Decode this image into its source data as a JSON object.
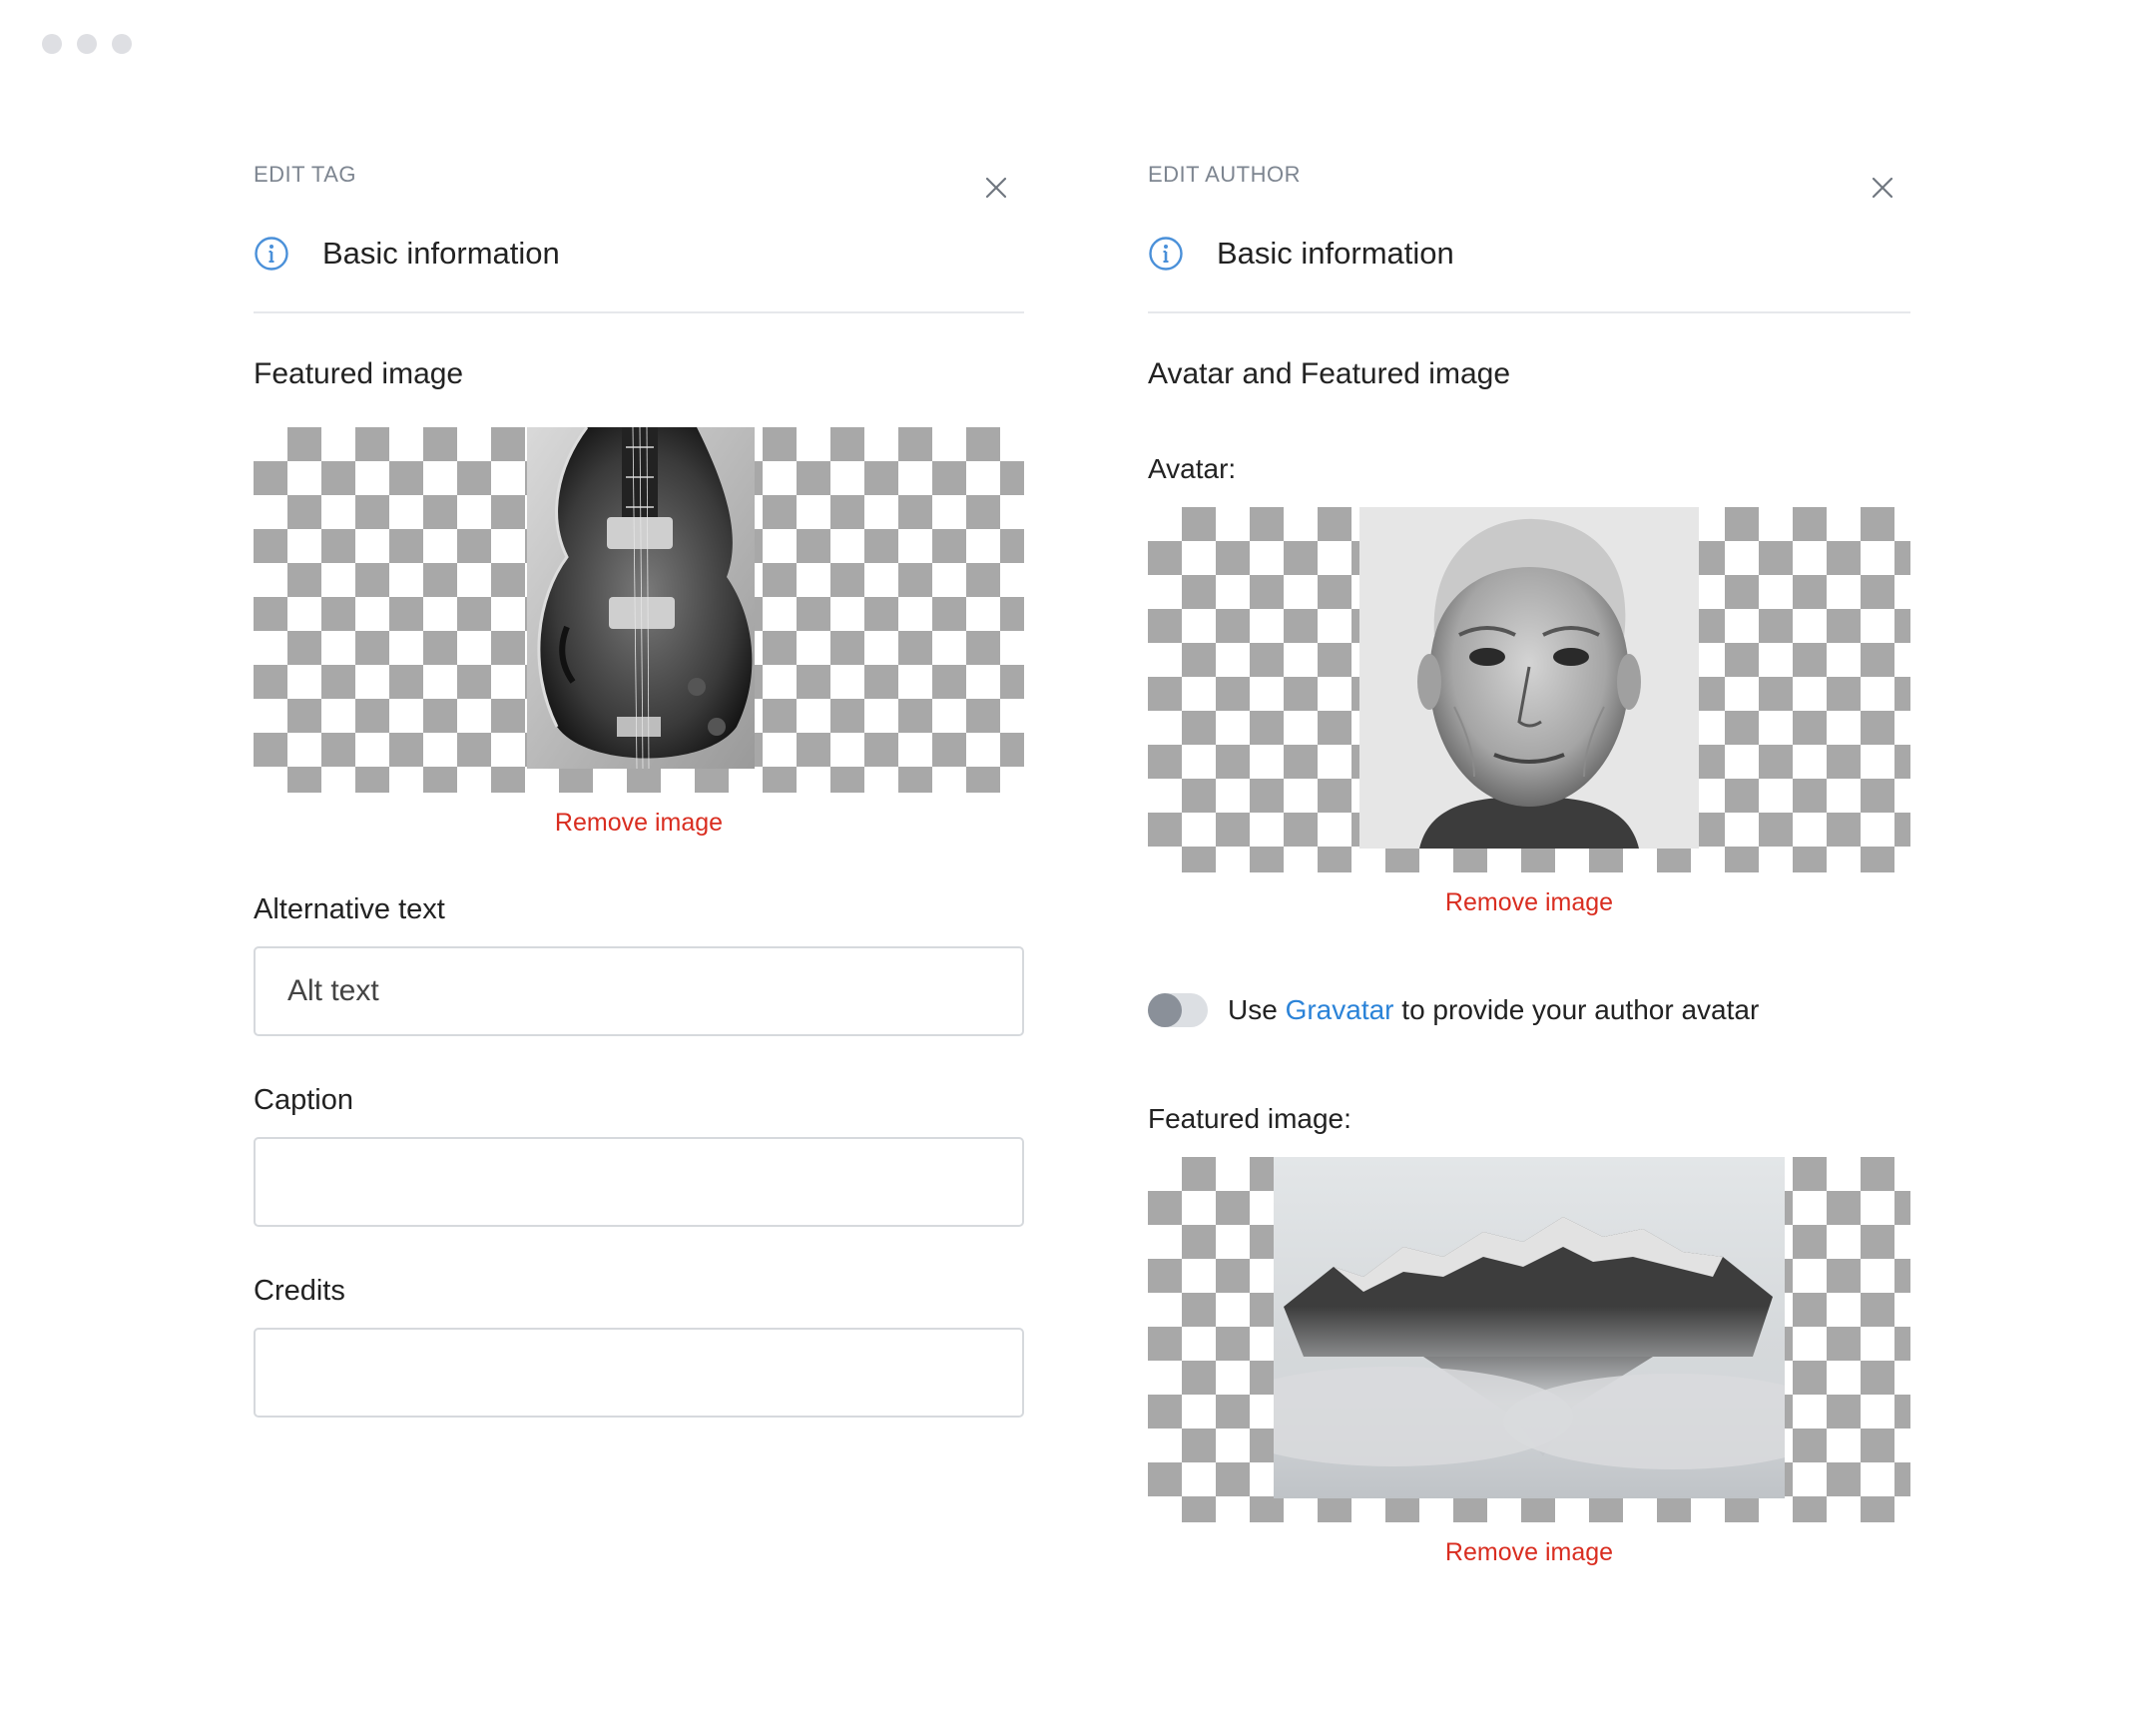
{
  "edit_tag": {
    "title": "EDIT TAG",
    "section": "Basic information",
    "featured_heading": "Featured image",
    "remove_label": "Remove image",
    "alt_label": "Alternative text",
    "alt_placeholder": "Alt text",
    "caption_label": "Caption",
    "caption_value": "",
    "credits_label": "Credits",
    "credits_value": ""
  },
  "edit_author": {
    "title": "EDIT AUTHOR",
    "section": "Basic information",
    "heading": "Avatar and Featured image",
    "avatar_label": "Avatar:",
    "avatar_remove": "Remove image",
    "gravatar_prefix": "Use ",
    "gravatar_link": "Gravatar",
    "gravatar_suffix": " to provide your author avatar",
    "gravatar_enabled": false,
    "featured_label": "Featured image:",
    "featured_remove": "Remove image"
  },
  "colors": {
    "danger": "#d92d20",
    "link": "#2b83d8",
    "info": "#4a90d9"
  }
}
